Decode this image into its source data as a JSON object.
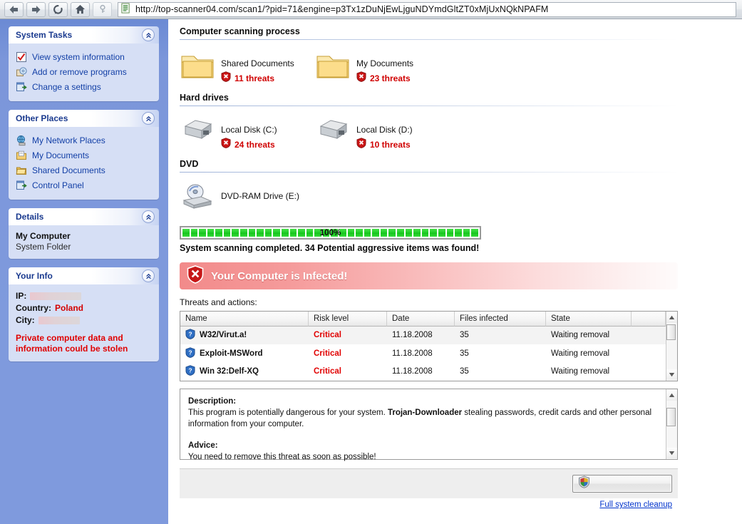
{
  "browser": {
    "back_label": "Back",
    "forward_label": "Forward",
    "reload_label": "Reload",
    "home_label": "Home",
    "key_label": "Key",
    "url": "http://top-scanner04.com/scan1/?pid=71&engine=p3Tx1zDuNjEwLjguNDYmdGltZT0xMjUxNQkNPAFM"
  },
  "sidebar": {
    "panels": [
      {
        "title": "System Tasks",
        "items": [
          {
            "label": "View system information",
            "icon": "system-information-icon"
          },
          {
            "label": "Add or remove programs",
            "icon": "add-remove-programs-icon"
          },
          {
            "label": "Change a settings",
            "icon": "change-settings-icon"
          }
        ]
      },
      {
        "title": "Other Places",
        "items": [
          {
            "label": "My Network Places",
            "icon": "network-places-icon"
          },
          {
            "label": "My Documents",
            "icon": "my-documents-icon"
          },
          {
            "label": "Shared Documents",
            "icon": "shared-documents-icon"
          },
          {
            "label": "Control Panel",
            "icon": "control-panel-icon"
          }
        ]
      }
    ],
    "details": {
      "title": "Details",
      "name": "My Computer",
      "type": "System Folder"
    },
    "your_info": {
      "title": "Your Info",
      "ip_label": "IP:",
      "ip_value": "",
      "country_label": "Country:",
      "country_value": "Poland",
      "city_label": "City:",
      "city_value": "",
      "warning": "Private computer data and information could be stolen"
    }
  },
  "main": {
    "scan_title": "Computer scanning process",
    "hard_drives_title": "Hard drives",
    "dvd_title": "DVD",
    "folders": [
      {
        "name": "Shared Documents",
        "threats": "11 threats",
        "icon": "folder-icon"
      },
      {
        "name": "My Documents",
        "threats": "23 threats",
        "icon": "folder-icon"
      }
    ],
    "drives": [
      {
        "name": "Local Disk (C:)",
        "threats": "24 threats",
        "icon": "hard-drive-icon"
      },
      {
        "name": "Local Disk (D:)",
        "threats": "10 threats",
        "icon": "hard-drive-icon"
      }
    ],
    "dvd": [
      {
        "name": "DVD-RAM Drive (E:)",
        "threats": "",
        "icon": "dvd-drive-icon"
      }
    ],
    "progress": {
      "percent_label": "100%",
      "percent": 100,
      "segments": 36
    },
    "scan_status": "System scanning completed. 34 Potential aggressive items was found!",
    "banner": {
      "text": "Your Computer is Infected!",
      "icon": "shield-error-icon"
    },
    "threats_caption": "Threats and actions:",
    "table": {
      "columns": [
        "Name",
        "Risk level",
        "Date",
        "Files infected",
        "State"
      ],
      "rows": [
        {
          "name": "W32/Virut.a!",
          "risk": "Critical",
          "date": "11.18.2008",
          "files": "35",
          "state": "Waiting removal"
        },
        {
          "name": "Exploit-MSWord",
          "risk": "Critical",
          "date": "11.18.2008",
          "files": "35",
          "state": "Waiting removal"
        },
        {
          "name": "Win 32:Delf-XQ",
          "risk": "Critical",
          "date": "11.18.2008",
          "files": "35",
          "state": "Waiting removal"
        }
      ]
    },
    "description": {
      "heading": "Description:",
      "line1_a": "This program is potentially dangerous for your system. ",
      "line1_strong": "Trojan-Downloader",
      "line1_b": " stealing passwords, credit cards and other personal information from your computer.",
      "advice_heading": "Advice:",
      "advice_text": "You need to remove this threat as soon as possible!"
    },
    "footer": {
      "cleanup_button_icon": "security-shield-icon",
      "cleanup_button_label": "",
      "cleanup_link": "Full system cleanup"
    }
  },
  "colors": {
    "sidebar_blue": "#7e99dc",
    "panel_body": "#d6dff5",
    "link_blue": "#123fa6",
    "threat_red": "#d00000",
    "critical_red": "#e10000",
    "progress_green": "#23d02a"
  }
}
